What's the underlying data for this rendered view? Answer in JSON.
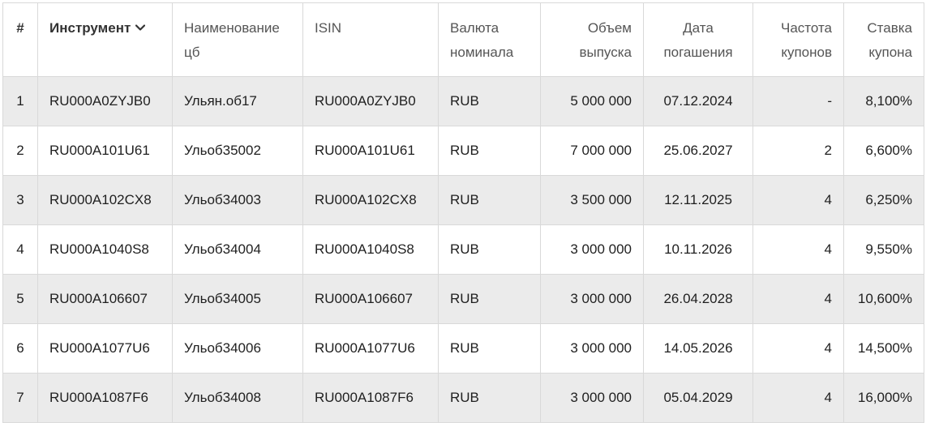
{
  "table": {
    "columns": [
      {
        "key": "idx",
        "label": "#"
      },
      {
        "key": "instrument",
        "label": "Инструмент"
      },
      {
        "key": "name",
        "label": "Наименование цб"
      },
      {
        "key": "isin",
        "label": "ISIN"
      },
      {
        "key": "currency",
        "label": "Валюта номинала"
      },
      {
        "key": "volume",
        "label": "Объем выпуска"
      },
      {
        "key": "maturity",
        "label": "Дата погашения"
      },
      {
        "key": "frequency",
        "label": "Частота купонов"
      },
      {
        "key": "rate",
        "label": "Ставка купона"
      }
    ],
    "sort_icon": "chevron-down-icon",
    "row_shade_color": "#ebebeb",
    "rows": [
      {
        "idx": "1",
        "instrument": "RU000A0ZYJB0",
        "name": "Ульян.об17",
        "isin": "RU000A0ZYJB0",
        "currency": "RUB",
        "volume": "5 000 000",
        "maturity": "07.12.2024",
        "frequency": "-",
        "rate": "8,100%"
      },
      {
        "idx": "2",
        "instrument": "RU000A101U61",
        "name": "Ульоб35002",
        "isin": "RU000A101U61",
        "currency": "RUB",
        "volume": "7 000 000",
        "maturity": "25.06.2027",
        "frequency": "2",
        "rate": "6,600%"
      },
      {
        "idx": "3",
        "instrument": "RU000A102CX8",
        "name": "Ульоб34003",
        "isin": "RU000A102CX8",
        "currency": "RUB",
        "volume": "3 500 000",
        "maturity": "12.11.2025",
        "frequency": "4",
        "rate": "6,250%"
      },
      {
        "idx": "4",
        "instrument": "RU000A1040S8",
        "name": "Ульоб34004",
        "isin": "RU000A1040S8",
        "currency": "RUB",
        "volume": "3 000 000",
        "maturity": "10.11.2026",
        "frequency": "4",
        "rate": "9,550%"
      },
      {
        "idx": "5",
        "instrument": "RU000A106607",
        "name": "Ульоб34005",
        "isin": "RU000A106607",
        "currency": "RUB",
        "volume": "3 000 000",
        "maturity": "26.04.2028",
        "frequency": "4",
        "rate": "10,600%"
      },
      {
        "idx": "6",
        "instrument": "RU000A1077U6",
        "name": "Ульоб34006",
        "isin": "RU000A1077U6",
        "currency": "RUB",
        "volume": "3 000 000",
        "maturity": "14.05.2026",
        "frequency": "4",
        "rate": "14,500%"
      },
      {
        "idx": "7",
        "instrument": "RU000A1087F6",
        "name": "Ульоб34008",
        "isin": "RU000A1087F6",
        "currency": "RUB",
        "volume": "3 000 000",
        "maturity": "05.04.2029",
        "frequency": "4",
        "rate": "16,000%"
      }
    ]
  }
}
